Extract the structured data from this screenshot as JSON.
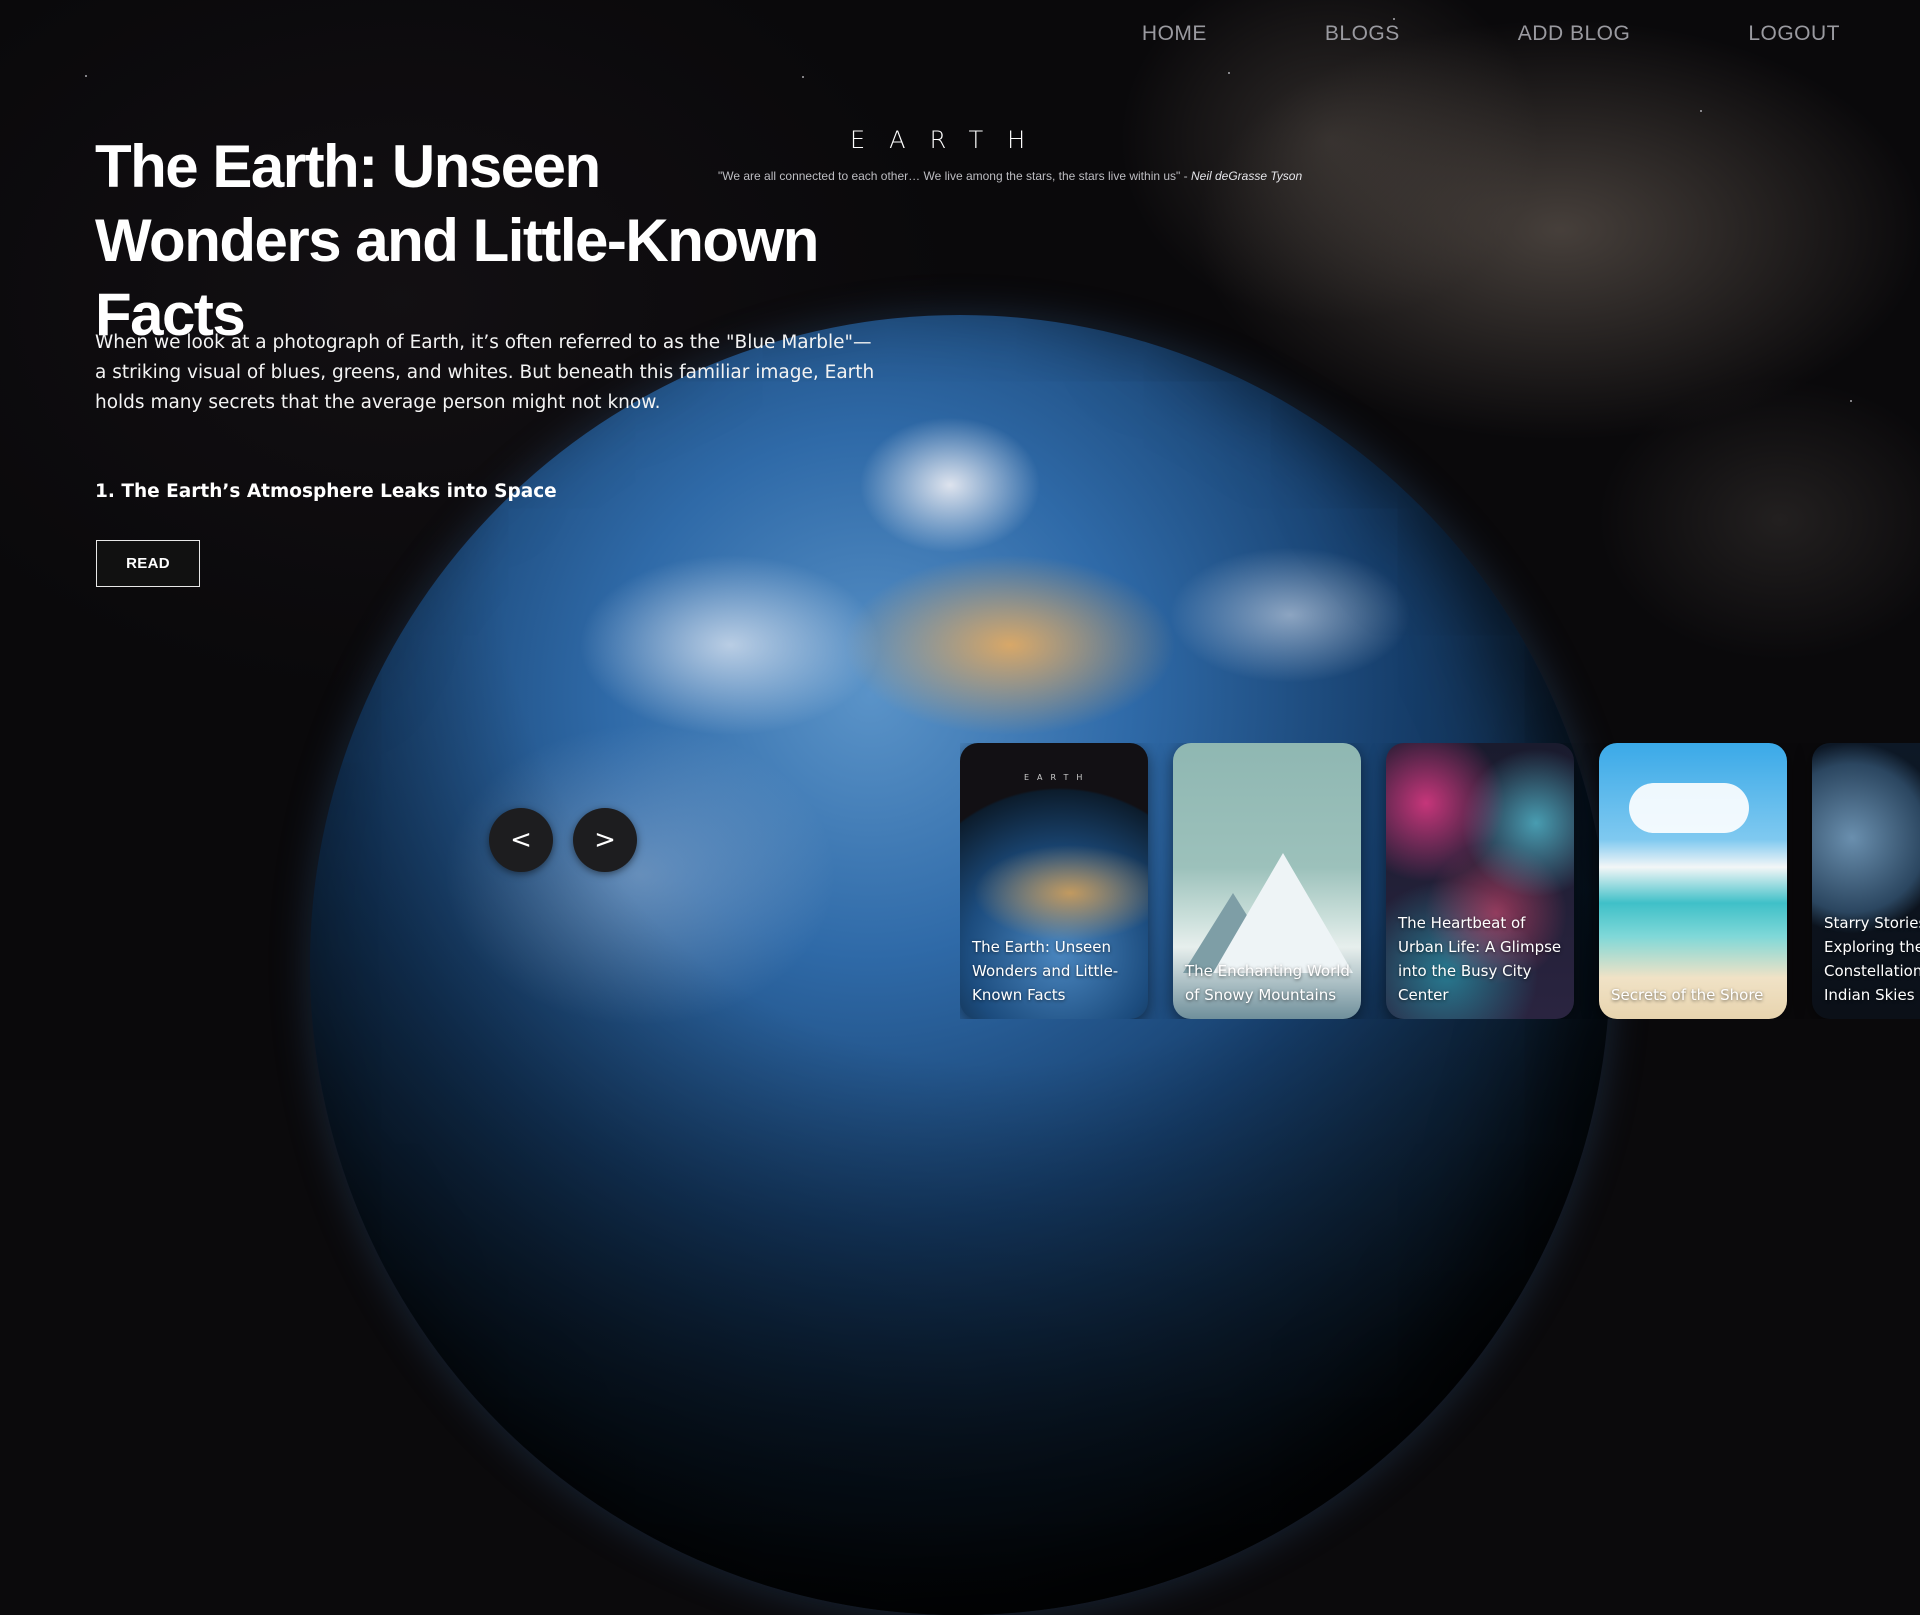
{
  "nav": {
    "items": [
      "HOME",
      "BLOGS",
      "ADD BLOG",
      "LOGOUT"
    ]
  },
  "brand": "EARTH",
  "quote": {
    "text": "\"We are all connected to each other… We live among the stars, the stars live within us\" -",
    "author": "Neil deGrasse Tyson"
  },
  "hero": {
    "title": "The Earth: Unseen Wonders and Little-Known Facts",
    "description": "When we look at a photograph of Earth, it’s often referred to as the \"Blue Marble\"—a striking visual of blues, greens, and whites. But beneath this familiar image, Earth holds many secrets that the average person might not know.",
    "point": "1. The Earth’s Atmosphere Leaks into Space",
    "read_label": "READ"
  },
  "carousel": {
    "prev_label": "<",
    "next_label": ">",
    "cards": [
      {
        "title": "The Earth: Unseen Wonders and Little-Known Facts"
      },
      {
        "title": "The Enchanting World of Snowy Mountains"
      },
      {
        "title": "The Heartbeat of Urban Life: A Glimpse into the Busy City Center"
      },
      {
        "title": "Secrets of the Shore"
      },
      {
        "title": "Starry Stories: Exploring the Constellations of Indian Skies"
      }
    ]
  },
  "colors": {
    "background": "#0a090b",
    "nav_text": "#9a9aa0",
    "button_bg": "#111111",
    "arrow_bg": "#1d1d1f"
  }
}
